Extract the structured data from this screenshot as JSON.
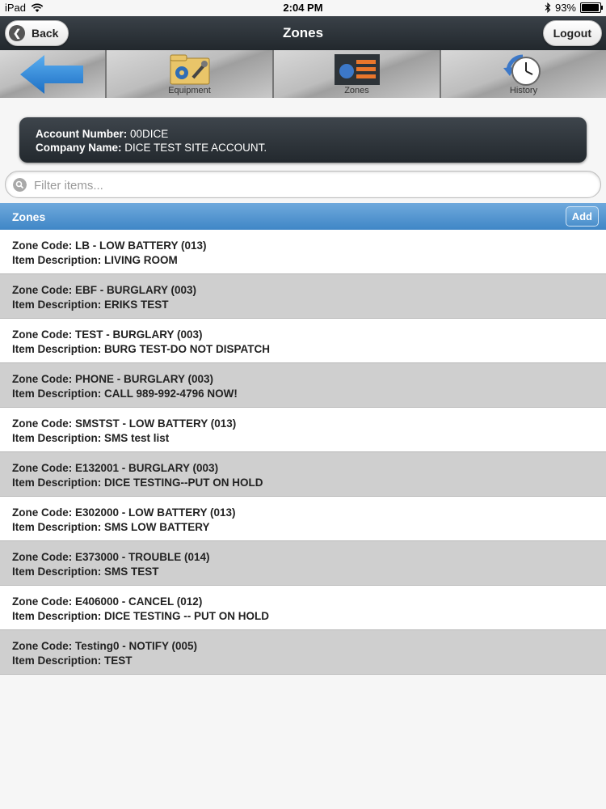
{
  "status_bar": {
    "device": "iPad",
    "time": "2:04 PM",
    "battery": "93%"
  },
  "header": {
    "title": "Zones",
    "back_label": "Back",
    "logout_label": "Logout"
  },
  "toolbar": {
    "items": [
      {
        "label": "",
        "icon": "back-arrow-icon"
      },
      {
        "label": "Equipment",
        "icon": "equipment-icon"
      },
      {
        "label": "Zones",
        "icon": "zones-icon"
      },
      {
        "label": "History",
        "icon": "history-clock-icon"
      }
    ]
  },
  "account": {
    "number_label": "Account Number:",
    "number_value": "00DICE",
    "company_label": "Company Name:",
    "company_value": "DICE TEST SITE ACCOUNT."
  },
  "filter": {
    "placeholder": "Filter items..."
  },
  "list_header": {
    "title": "Zones",
    "add_label": "Add"
  },
  "zones": [
    {
      "code": "Zone Code: LB - LOW BATTERY (013)",
      "desc": "Item Description: LIVING ROOM"
    },
    {
      "code": "Zone Code: EBF - BURGLARY (003)",
      "desc": "Item Description: ERIKS TEST"
    },
    {
      "code": "Zone Code: TEST - BURGLARY (003)",
      "desc": "Item Description: BURG TEST-DO NOT DISPATCH"
    },
    {
      "code": "Zone Code: PHONE - BURGLARY (003)",
      "desc": "Item Description: CALL 989-992-4796 NOW!"
    },
    {
      "code": "Zone Code: SMSTST - LOW BATTERY (013)",
      "desc": "Item Description: SMS test list"
    },
    {
      "code": "Zone Code: E132001 - BURGLARY (003)",
      "desc": "Item Description: DICE TESTING--PUT ON HOLD"
    },
    {
      "code": "Zone Code: E302000 - LOW BATTERY (013)",
      "desc": "Item Description: SMS LOW BATTERY"
    },
    {
      "code": "Zone Code: E373000 - TROUBLE (014)",
      "desc": "Item Description: SMS TEST"
    },
    {
      "code": "Zone Code: E406000 - CANCEL (012)",
      "desc": "Item Description: DICE TESTING -- PUT ON HOLD"
    },
    {
      "code": "Zone Code: Testing0 - NOTIFY (005)",
      "desc": "Item Description: TEST"
    }
  ]
}
